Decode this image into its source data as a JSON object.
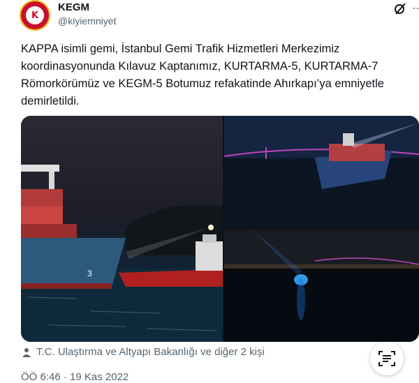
{
  "author": {
    "name": "KEGM",
    "handle": "@kiyiemniyet",
    "avatar_icon": "kegm-emblem-icon",
    "avatar_text": "K"
  },
  "tweet": {
    "text": "KAPPA isimli gemi, İstanbul Gemi Trafik Hizmetleri Merkezimiz koordinasyonunda Kılavuz Kaptanımız, KURTARMA-5, KURTARMA-7 Römorkörümüz ve KEGM-5 Botumuz refakatinde Ahırkapı’ya emniyetle demirletildi.",
    "tagged": "T.C. Ulaştırma ve Altyapı Bakanlığı ve diğer 2 kişi",
    "timestamp": "ÖÖ 6:46 · 19 Kas 2022"
  },
  "icons": {
    "grok": "grok-icon",
    "more": "more-icon",
    "tagged": "person-icon",
    "lens": "scan-text-icon"
  },
  "photos": {
    "p1_hull_number": "3"
  },
  "colors": {
    "accent": "#c8102e",
    "secondary_text": "#536471"
  }
}
